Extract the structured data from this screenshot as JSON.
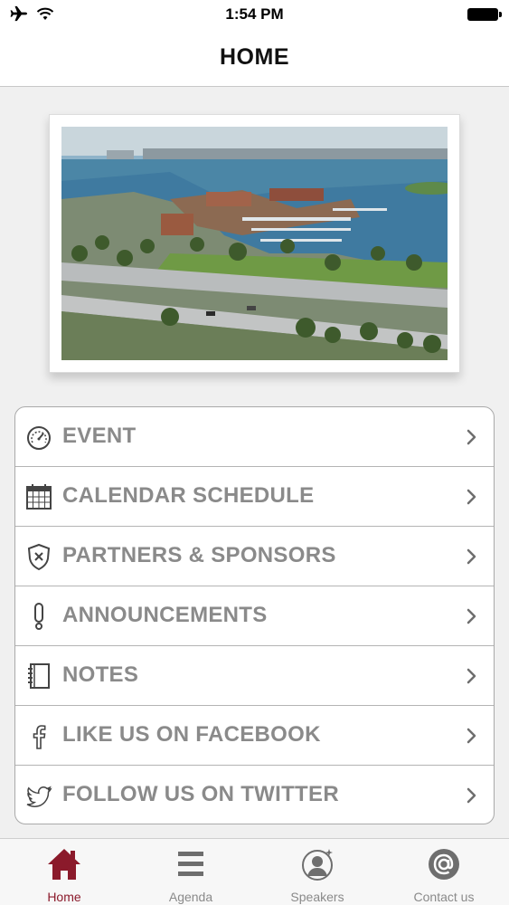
{
  "status_bar": {
    "time": "1:54 PM"
  },
  "nav": {
    "title": "HOME"
  },
  "menu": {
    "items": [
      {
        "label": "EVENT",
        "icon": "speedometer-icon"
      },
      {
        "label": "CALENDAR SCHEDULE",
        "icon": "calendar-icon"
      },
      {
        "label": "PARTNERS & SPONSORS",
        "icon": "shield-icon"
      },
      {
        "label": "ANNOUNCEMENTS",
        "icon": "exclamation-icon"
      },
      {
        "label": "NOTES",
        "icon": "notebook-icon"
      },
      {
        "label": "LIKE US ON FACEBOOK",
        "icon": "facebook-icon"
      },
      {
        "label": "FOLLOW US ON TWITTER",
        "icon": "twitter-icon"
      }
    ]
  },
  "tabs": [
    {
      "label": "Home",
      "icon": "home-icon",
      "active": true
    },
    {
      "label": "Agenda",
      "icon": "list-icon",
      "active": false
    },
    {
      "label": "Speakers",
      "icon": "speaker-icon",
      "active": false
    },
    {
      "label": "Contact us",
      "icon": "at-icon",
      "active": false
    }
  ],
  "colors": {
    "accent": "#8b1a2b",
    "menu_text": "#8a8a8a",
    "tab_text": "#8a8a8a"
  }
}
